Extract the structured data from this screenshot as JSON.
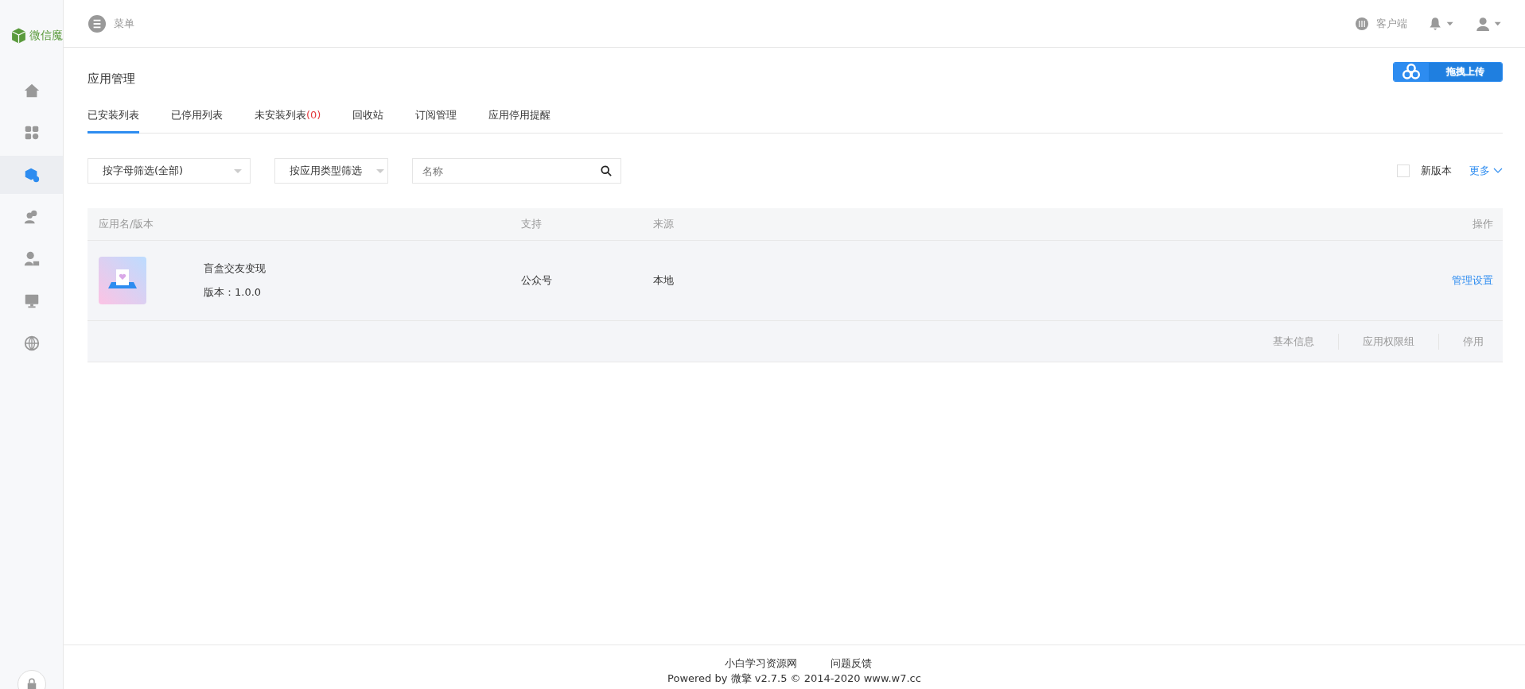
{
  "brand": {
    "name": "微信魔"
  },
  "sidebar": {
    "items": [
      {
        "kind": "home",
        "selected": false
      },
      {
        "kind": "apps",
        "selected": false
      },
      {
        "kind": "module",
        "selected": true
      },
      {
        "kind": "users",
        "selected": false
      },
      {
        "kind": "lock-user",
        "selected": false
      },
      {
        "kind": "monitor",
        "selected": false
      },
      {
        "kind": "globe",
        "selected": false
      }
    ]
  },
  "header": {
    "menu_label": "菜单",
    "client_label": "客户端"
  },
  "page": {
    "title": "应用管理",
    "upload_button": "拖拽上传"
  },
  "tabs": [
    {
      "label": "已安装列表",
      "selected": true
    },
    {
      "label": "已停用列表",
      "selected": false
    },
    {
      "label": "未安装列表",
      "count": "(0)",
      "selected": false
    },
    {
      "label": "回收站",
      "selected": false
    },
    {
      "label": "订阅管理",
      "selected": false
    },
    {
      "label": "应用停用提醒",
      "selected": false
    }
  ],
  "filters": {
    "letter": "按字母筛选(全部)",
    "type": "按应用类型筛选",
    "search_placeholder": "名称",
    "new_version": {
      "label": "新版本",
      "checked": false
    },
    "more": "更多"
  },
  "table": {
    "columns": [
      "应用名/版本",
      "支持",
      "来源",
      "操作"
    ],
    "rows": [
      {
        "name": "盲盒交友变现",
        "version": "版本：1.0.0",
        "support": "公众号",
        "source": "本地",
        "action": "管理设置",
        "sub_actions": [
          "基本信息",
          "应用权限组",
          "停用"
        ]
      }
    ]
  },
  "footer": {
    "links": [
      "小白学习资源网",
      "问题反馈"
    ],
    "powered": "Powered by 微擎 v2.7.5 © 2014-2020 www.w7.cc"
  }
}
